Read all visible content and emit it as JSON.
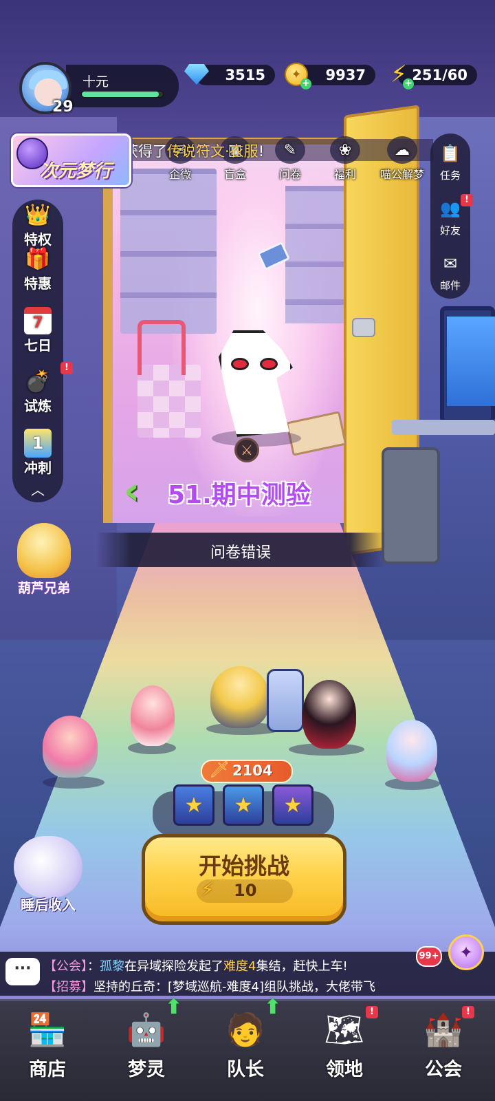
{
  "player": {
    "name": "十元",
    "level": "29",
    "exp_progress": 0.95
  },
  "resources": {
    "gems": "3515",
    "coins": "9937",
    "energy": "251/60"
  },
  "ticker": {
    "prefix": "符文秘藏获得了",
    "highlight": "传说符文·衣服",
    "suffix": "!"
  },
  "event_banner": {
    "label": "次元梦行"
  },
  "quick_menu": [
    {
      "label": "企微",
      "icon": "wechat-work-icon"
    },
    {
      "label": "盲盒",
      "icon": "blind-box-icon"
    },
    {
      "label": "问卷",
      "icon": "survey-icon"
    },
    {
      "label": "福利",
      "icon": "gift-icon"
    },
    {
      "label": "喵公解梦",
      "icon": "cat-dream-icon"
    }
  ],
  "right_menu": [
    {
      "label": "任务",
      "icon": "task-icon",
      "badge": ""
    },
    {
      "label": "好友",
      "icon": "friends-icon",
      "badge": "!"
    },
    {
      "label": "邮件",
      "icon": "mail-icon",
      "badge": ""
    }
  ],
  "left_menu": [
    {
      "label": "特权",
      "icon": "privilege-icon",
      "badge": ""
    },
    {
      "label": "特惠",
      "icon": "special-offer-icon",
      "badge": ""
    },
    {
      "label": "七日",
      "icon": "seven-day-calendar-icon",
      "badge": "",
      "calendar_day": "7"
    },
    {
      "label": "试炼",
      "icon": "trial-cannon-icon",
      "badge": "!"
    },
    {
      "label": "冲刺",
      "icon": "sprint-icon",
      "badge": "",
      "number": "1"
    }
  ],
  "gourd": {
    "label": "葫芦兄弟"
  },
  "stage": {
    "title": "51.期中测验",
    "subtitle": "问卷错误"
  },
  "team": {
    "power": "2104"
  },
  "reward_boxes": [
    {
      "color": "#4a7fe0"
    },
    {
      "color": "#4a9ae8"
    },
    {
      "color": "#8a5ad8"
    }
  ],
  "start": {
    "label": "开始挑战",
    "cost": "10"
  },
  "sleep_income": {
    "label": "睡后收入"
  },
  "chat": {
    "unread": "99+",
    "lines": [
      {
        "tag": "【公会】",
        "sep": "：",
        "who": "孤黎",
        "pre": "在异域探险发起了",
        "hl": "难度4",
        "post": "集结，赶快上车!"
      },
      {
        "tag": "【招募】",
        "sep": "",
        "who": "",
        "pre": "坚持的丘奇：[梦域巡航-难度4]组队挑战，大佬带飞",
        "hl": "",
        "post": ""
      }
    ]
  },
  "bottom_nav": [
    {
      "label": "商店",
      "icon": "shop-icon",
      "badge": "",
      "upgrade": false
    },
    {
      "label": "梦灵",
      "icon": "dream-spirit-icon",
      "badge": "",
      "upgrade": true
    },
    {
      "label": "队长",
      "icon": "captain-icon",
      "badge": "",
      "upgrade": true
    },
    {
      "label": "领地",
      "icon": "territory-icon",
      "badge": "!",
      "upgrade": false
    },
    {
      "label": "公会",
      "icon": "guild-icon",
      "badge": "!",
      "upgrade": false
    }
  ]
}
